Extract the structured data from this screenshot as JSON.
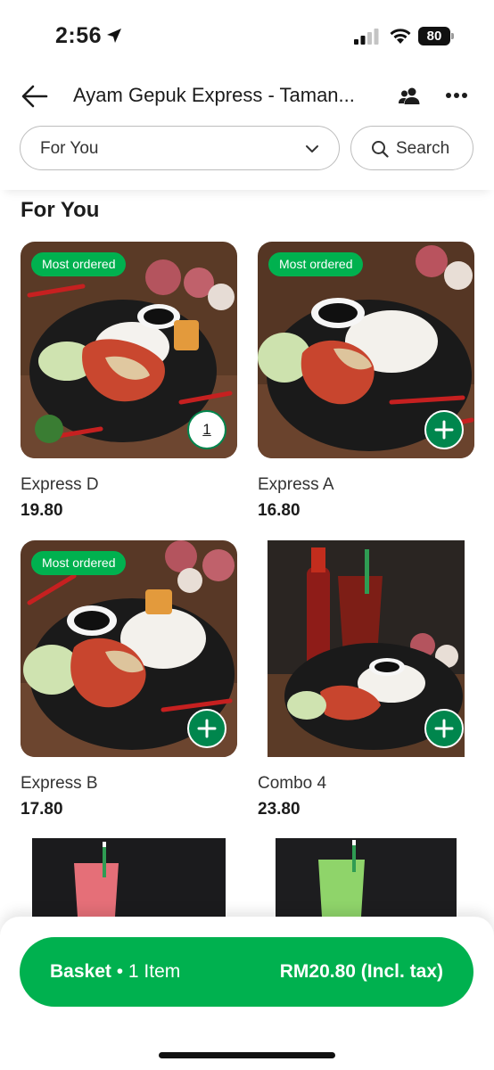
{
  "status_bar": {
    "time": "2:56",
    "battery": "80"
  },
  "header": {
    "title": "Ayam Gepuk Express - Taman..."
  },
  "filter": {
    "category": "For You",
    "search_label": "Search"
  },
  "section": {
    "title": "For You"
  },
  "items": [
    {
      "name": "Express D",
      "price": "19.80",
      "badge": "Most ordered",
      "quantity": "1"
    },
    {
      "name": "Express A",
      "price": "16.80",
      "badge": "Most ordered"
    },
    {
      "name": "Express B",
      "price": "17.80",
      "badge": "Most ordered"
    },
    {
      "name": "Combo 4",
      "price": "23.80"
    },
    {
      "name": "",
      "price": ""
    },
    {
      "name": "",
      "price": ""
    }
  ],
  "basket": {
    "label": "Basket",
    "separator": " • ",
    "count": "1 Item",
    "total": "RM20.80 (Incl. tax)"
  },
  "colors": {
    "brand_green": "#00b14f",
    "dark_green": "#00864d"
  }
}
